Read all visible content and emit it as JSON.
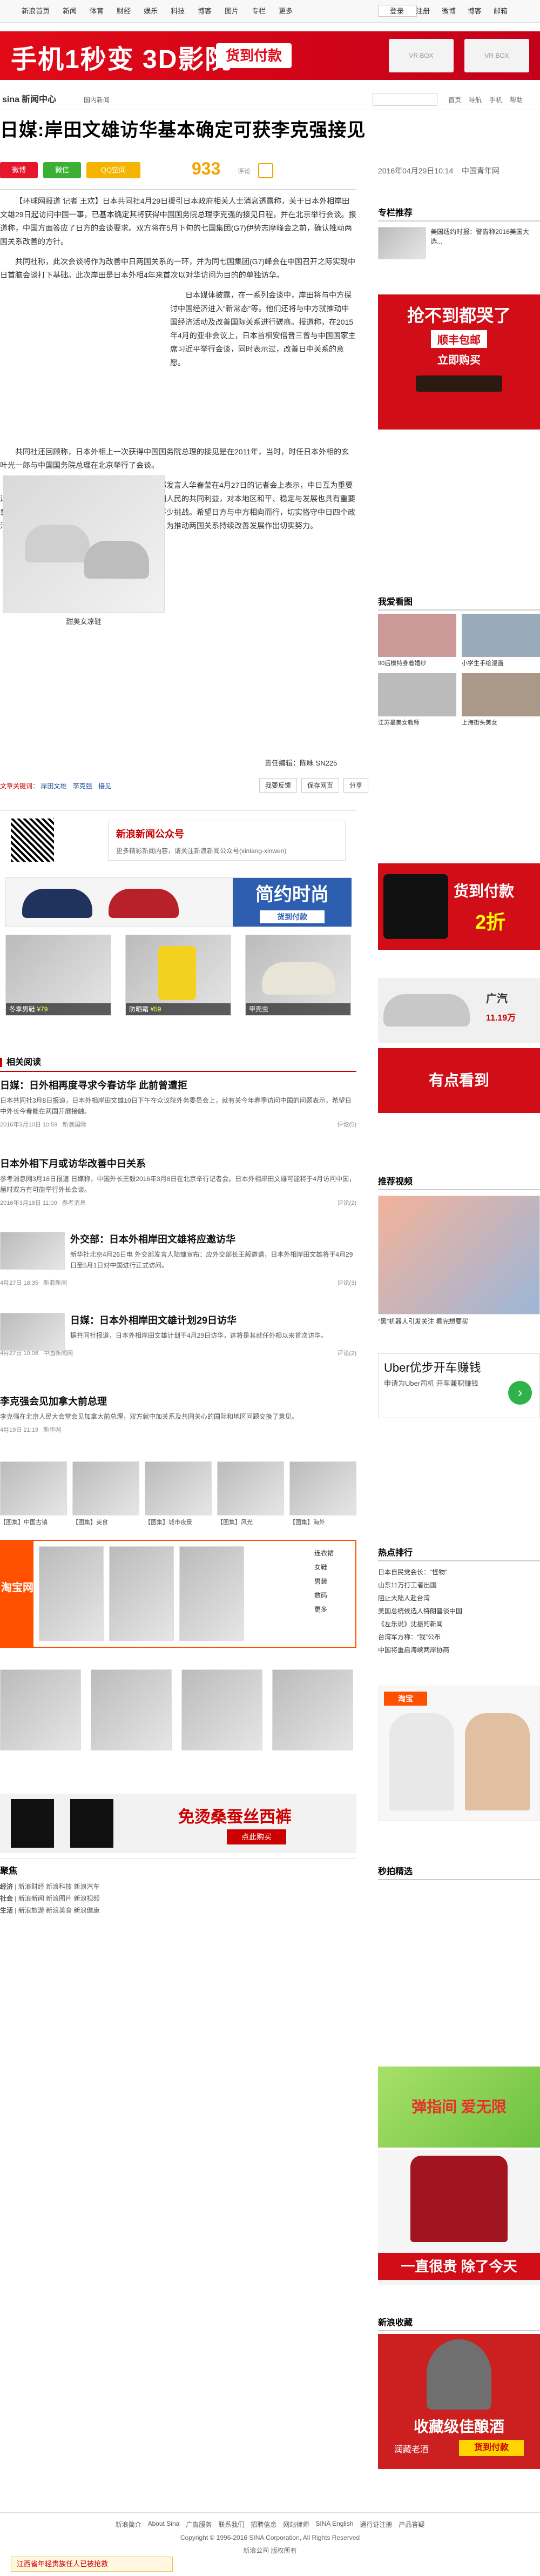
{
  "topnav": {
    "items": [
      "新浪首页",
      "新闻",
      "体育",
      "财经",
      "娱乐",
      "科技",
      "博客",
      "图片",
      "专栏",
      "更多"
    ],
    "right_items": [
      "登录",
      "注册",
      "微博",
      "博客",
      "邮箱"
    ]
  },
  "banner": {
    "headline": "手机1秒变 3D影院",
    "cta": "货到付款",
    "product_a": "VR BOX",
    "product_b": "VR BOX"
  },
  "site": {
    "logo": "sina",
    "channel": "新闻中心",
    "breadcrumb": "国内新闻",
    "header_links": [
      "首页",
      "导航",
      "手机",
      "帮助"
    ]
  },
  "article": {
    "title": "日媒:岸田文雄访华基本确定可获李克强接见",
    "share_buttons": [
      "微博",
      "微信",
      "QQ空间"
    ],
    "comment_count": "933",
    "comment_label": "评论",
    "publish_time": "2016年04月29日10:14",
    "source": "中国青年网",
    "paragraphs": [
      "【环球网报道 记者 王欢】日本共同社4月29日援引日本政府相关人士消息透露称，关于日本外相岸田文雄29日起访问中国一事，已基本确定其将获得中国国务院总理李克强的接见日程，并在北京举行会谈。报道称，中国方面答应了日方的会谈要求。双方将在5月下旬的七国集团(G7)伊势志摩峰会之前，确认推动两国关系改善的方针。",
      "共同社称，此次会谈将作为改善中日两国关系的一环，并为同七国集团(G7)峰会在中国召开之际实现中日首脑会谈打下基础。此次岸田是日本外相4年来首次以对华访问为目的的单独访华。",
      "日本媒体披露，在一系列会谈中，岸田将与中方探讨中国经济进入“新常态”等。他们还将与中方就推动中国经济活动及改善国际关系进行磋商。报道称，在2015年4月的亚非会议上，日本首相安倍晋三曾与中国国家主席习近平举行会谈，同时表示过，改善日中关系的意愿。",
      "共同社还回顾称，日本外相上一次获得中国国务院总理的接见是在2011年，当时，时任日本外相的玄叶光一郎与中国国务院总理在北京举行了会谈。",
      "有关日本外相岸田文雄访问中国，中国外交部发言人华春莹在4月27日的记者会上表示，中日互为重要近邻，保持中日关系健康稳定发展符合两国和两国人民的共同利益，对本地区和平、稳定与发展也具有重要意义。当前中日关系出现改善势头，同时也面临不少挑战。希望日方与中方相向而行，切实恪守中日四个政治文件和四点原则共识精神，妥善处理有关问题，为推动两国关系持续改善发展作出切实努力。",
      "（来源：环球网）"
    ],
    "image_caption": "甜美女凉鞋",
    "editor_label": "责任编辑：",
    "editor": "陈咏 SN225",
    "tag_label": "文章关键词：",
    "tags": [
      "岸田文雄",
      "李克强",
      "接见"
    ],
    "actions": [
      "我要反馈",
      "保存网页",
      "分享"
    ]
  },
  "subscribe": {
    "title": "新浪新闻公众号",
    "subtitle": "更多精彩新闻内容，请关注新浪新闻公众号(xinlang-xinwen)"
  },
  "products": {
    "banner_text": "简约时尚",
    "banner_cta": "货到付款",
    "items": [
      {
        "label": "冬季男鞋",
        "price": "¥79"
      },
      {
        "label": "防晒霜",
        "price": "¥59"
      },
      {
        "label": "甲壳虫",
        "price": ""
      }
    ]
  },
  "related": {
    "header": "相关阅读",
    "items": [
      {
        "title": "日媒：日外相再度寻求今春访华 此前曾遭拒",
        "summary": "日本共同社3月8日报道，日本外相岸田文雄10日下午在众议院外务委员会上，就有关今年春季访问中国的问题表示，希望日中外长今春能在两国开展接触。",
        "time": "2016年3月10日 10:59",
        "channel": "新浪国际",
        "comments": "评论(5)"
      },
      {
        "title": "日本外相下月或访华改善中日关系",
        "summary": "参考消息网3月18日报道 日媒称，中国外长王毅2016年3月8日在北京举行记者会。日本外相岸田文雄可能将于4月访问中国，届时双方有可能举行外长会谈。",
        "time": "2016年3月18日 11:00",
        "channel": "参考消息",
        "comments": "评论(2)"
      },
      {
        "title": "外交部：日本外相岸田文雄将应邀访华",
        "summary": "新华社北京4月26日电 外交部发言人陆慷宣布：应外交部长王毅邀请，日本外相岸田文雄将于4月29日至5月1日对中国进行正式访问。",
        "time": "4月27日 18:35",
        "channel": "新浪新闻",
        "comments": "评论(3)"
      },
      {
        "title": "日媒：日本外相岸田文雄计划29日访华",
        "summary": "据共同社报道，日本外相岸田文雄计划于4月29日访华，这将是其就任外相以来首次访华。",
        "time": "4月27日 10:06",
        "channel": "中国新闻网",
        "comments": "评论(2)"
      },
      {
        "title": "李克强会见加拿大前总理",
        "summary": "李克强在北京人民大会堂会见加拿大前总理，双方就中加关系及共同关心的国际和地区问题交换了意见。",
        "time": "4月19日 21:19",
        "channel": "新华网",
        "comments": ""
      }
    ]
  },
  "gallery": {
    "captions": [
      "【图集】中国古镇",
      "【图集】美食",
      "【图集】城市夜景",
      "【图集】风光",
      "【图集】海外"
    ]
  },
  "taobao": {
    "label": "淘宝网",
    "menu": [
      "连衣裙",
      "女鞋",
      "男装",
      "数码",
      "更多"
    ],
    "promo": "免烫桑蚕丝西裤",
    "promo_cta": "点此购买"
  },
  "bottom_tags": {
    "header": "聚焦",
    "groups": [
      {
        "name": "经济",
        "links": [
          "新浪财经",
          "新浪科技",
          "新浪汽车"
        ]
      },
      {
        "name": "社会",
        "links": [
          "新浪新闻",
          "新浪图片",
          "新浪视频"
        ]
      },
      {
        "name": "生活",
        "links": [
          "新浪旅游",
          "新浪美食",
          "新浪健康"
        ]
      }
    ]
  },
  "right": {
    "recommend_header": "专栏推荐",
    "recommend_text": "美国纽约时报：警告称2016美国大选...",
    "ad1_text": "抢不到都哭了",
    "ad1_sub": "顺丰包邮",
    "ad1_cta": "立即购买",
    "hotpics_header": "我爱看图",
    "hotpics": [
      {
        "caption": "90后模特身着婚纱",
        "color": "#c99"
      },
      {
        "caption": "小学生手绘漫画",
        "color": "#9ab"
      },
      {
        "caption": "江苏最美女教师",
        "color": "#bbb"
      },
      {
        "caption": "上海街头美女",
        "color": "#a98"
      }
    ],
    "ad2_text": "货到付款",
    "ad2_price": "2折",
    "car_ad": {
      "brand": "广汽",
      "price": "11.19万"
    },
    "ad3_text": "有点看到",
    "video_header": "推荐视频",
    "video_caption": "“黑”机器人引发关注 看完想要买",
    "uber_title": "Uber优步开车赚钱",
    "uber_sub": "申请为Uber司机 开车兼职赚钱",
    "hotnews_header": "热点排行",
    "hotnews": [
      "日本自民党会长：“怪物”",
      "山东11万打工者出国",
      "阻止大陆人赴台湾",
      "美国总统候选人特朗普谈中国",
      "《左乐说》沈振的新闻",
      "台湾军方称：“我”公布",
      "中国将重启海峡两岸协商"
    ],
    "ad4_text": "淘宝",
    "second_header": "秒拍精选",
    "ad5_text": "弹指间 爱无限",
    "ad6_text": "一直很贵 除了今天",
    "art_header": "新浪收藏",
    "ad7_text": "收藏级佳酿酒",
    "ad7_sub": "润藏老酒",
    "ad7_cta": "货到付款"
  },
  "footer": {
    "links": [
      "新浪简介",
      "About Sina",
      "广告服务",
      "联系我们",
      "招聘信息",
      "网站律师",
      "SINA English",
      "通行证注册",
      "产品答疑"
    ],
    "copyright": "Copyright © 1996-2016 SINA Corporation, All Rights Reserved",
    "company": "新浪公司 版权所有",
    "notice": "江西省年轻贵族任人已被抢救"
  }
}
